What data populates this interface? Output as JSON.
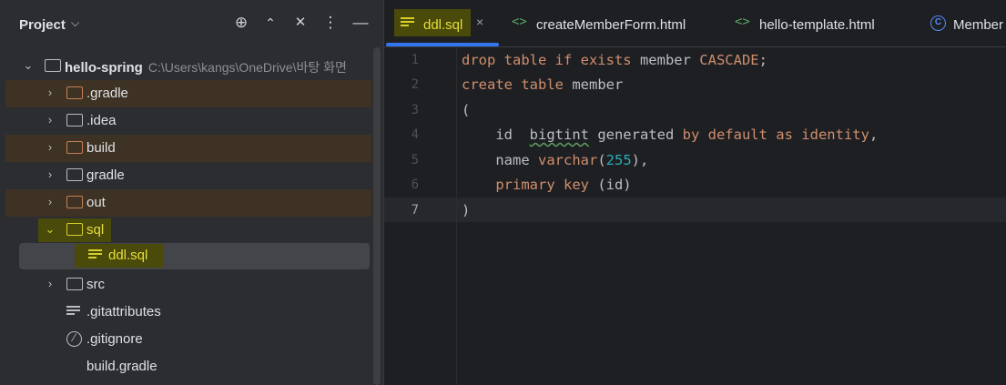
{
  "project_panel": {
    "title": "Project",
    "header_icons": [
      "crosshair-icon",
      "expand-icon",
      "collapse-icon",
      "more-icon",
      "minimize-icon"
    ],
    "root": {
      "name": "hello-spring",
      "path": "C:\\Users\\kangs\\OneDrive\\바탕 화면"
    },
    "items": [
      {
        "label": ".gradle",
        "type": "folder",
        "color": "#c67f55"
      },
      {
        "label": ".idea",
        "type": "folder"
      },
      {
        "label": "build",
        "type": "folder",
        "color": "#c67f55"
      },
      {
        "label": "gradle",
        "type": "folder"
      },
      {
        "label": "out",
        "type": "folder",
        "color": "#c67f55"
      },
      {
        "label": "sql",
        "type": "folder",
        "expanded": true
      },
      {
        "label": "ddl.sql",
        "type": "file",
        "selected": true
      },
      {
        "label": "src",
        "type": "folder"
      },
      {
        "label": ".gitattributes",
        "type": "file"
      },
      {
        "label": ".gitignore",
        "type": "file"
      },
      {
        "label": "build.gradle",
        "type": "file"
      }
    ]
  },
  "tabs": [
    {
      "label": "ddl.sql",
      "active": true,
      "icon": "text-file-icon"
    },
    {
      "label": "createMemberForm.html",
      "icon": "html-icon"
    },
    {
      "label": "hello-template.html",
      "icon": "html-icon"
    },
    {
      "label": "Member",
      "icon": "class-icon"
    }
  ],
  "editor": {
    "line_numbers": [
      "1",
      "2",
      "3",
      "4",
      "5",
      "6",
      "7"
    ],
    "current_line": 7,
    "lines": [
      [
        {
          "t": "drop table if exists ",
          "c": "kw"
        },
        {
          "t": "member ",
          "c": "id"
        },
        {
          "t": "CASCADE",
          "c": "kw"
        },
        {
          "t": ";",
          "c": "id"
        }
      ],
      [
        {
          "t": "create table ",
          "c": "kw"
        },
        {
          "t": "member",
          "c": "id"
        }
      ],
      [
        {
          "t": "(",
          "c": "id"
        }
      ],
      [
        {
          "t": "    id  ",
          "c": "id"
        },
        {
          "t": "bigtint",
          "c": "id",
          "squig": true
        },
        {
          "t": " generated ",
          "c": "id"
        },
        {
          "t": "by default as identity",
          "c": "kw"
        },
        {
          "t": ",",
          "c": "id"
        }
      ],
      [
        {
          "t": "    name ",
          "c": "id"
        },
        {
          "t": "varchar",
          "c": "kw"
        },
        {
          "t": "(",
          "c": "id"
        },
        {
          "t": "255",
          "c": "num"
        },
        {
          "t": "),",
          "c": "id"
        }
      ],
      [
        {
          "t": "    ",
          "c": "id"
        },
        {
          "t": "primary key",
          "c": "kw"
        },
        {
          "t": " (id)",
          "c": "id"
        }
      ],
      [
        {
          "t": ")",
          "c": "id"
        }
      ]
    ]
  }
}
